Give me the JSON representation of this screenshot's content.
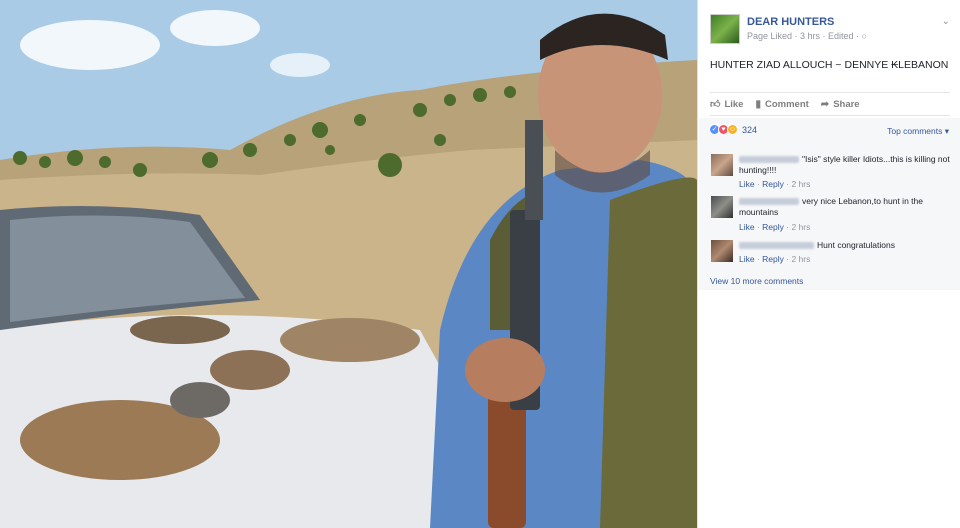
{
  "post": {
    "page_name": "DEAR HUNTERS",
    "meta": "Page Liked · 3 hrs · Edited · ",
    "text": "HUNTER ZIAD ALLOUCH ~ DENNYE ₭LEBANON",
    "actions": {
      "like": "Like",
      "comment": "Comment",
      "share": "Share"
    }
  },
  "reactions": {
    "count": "324"
  },
  "sort": {
    "label": "Top comments ▾"
  },
  "comments": [
    {
      "text": "\"Isis\" style killer Idiots...this is killing not hunting!!!!",
      "like": "Like",
      "reply": "Reply",
      "time": "· 2 hrs"
    },
    {
      "text": "very nice Lebanon,to hunt in the mountains",
      "like": "Like",
      "reply": "Reply",
      "time": "· 2 hrs"
    },
    {
      "text": "Hunt congratulations",
      "like": "Like",
      "reply": "Reply",
      "time": "· 2 hrs"
    }
  ],
  "more_comments": "View 10 more comments",
  "icons": [
    "like-icon",
    "comment-icon",
    "share-icon",
    "chevron-down-icon",
    "globe-icon"
  ],
  "colors": {
    "link": "#365899",
    "meta": "#90949c",
    "panel_bg": "#f6f7f9"
  }
}
